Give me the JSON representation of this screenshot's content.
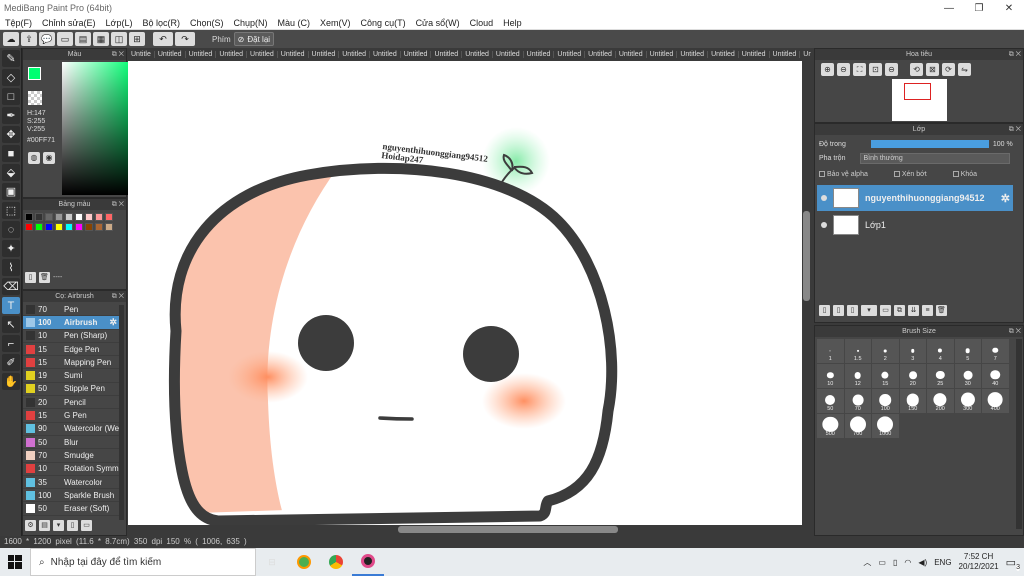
{
  "window": {
    "title": "MediBang Paint Pro (64bit)",
    "controls": [
      "—",
      "❐",
      "✕"
    ]
  },
  "menu": [
    "Tệp(F)",
    "Chỉnh sửa(E)",
    "Lớp(L)",
    "Bộ lọc(R)",
    "Chọn(S)",
    "Chụp(N)",
    "Màu (C)",
    "Xem(V)",
    "Công cụ(T)",
    "Cửa sổ(W)",
    "Cloud",
    "Help"
  ],
  "toolbar": {
    "label": "Phím",
    "reset_label": "Đặt lại",
    "reset_icon": "⊘"
  },
  "color_panel": {
    "title": "Màu",
    "h": "H:147",
    "s": "S:255",
    "v": "V:255",
    "hex": "#00FF71"
  },
  "palette_panel": {
    "title": "Bảng màu",
    "footer_text": "----",
    "colors": [
      "#000000",
      "#333333",
      "#666666",
      "#999999",
      "#cccccc",
      "#ffffff",
      "#ffcccc",
      "#ff9999",
      "#ff6666",
      "#ff0000",
      "#00ff00",
      "#0000ff",
      "#ffff00",
      "#00ffff",
      "#ff00ff",
      "#884400",
      "#aa6633",
      "#ccaa88"
    ]
  },
  "brush_panel": {
    "title": "Cọ: Airbrush",
    "brushes": [
      {
        "size": "70",
        "name": "Pen",
        "color": "#333333"
      },
      {
        "size": "100",
        "name": "Airbrush",
        "color": "#9ec8e8"
      },
      {
        "size": "10",
        "name": "Pen (Sharp)",
        "color": "#333333"
      },
      {
        "size": "15",
        "name": "Edge Pen",
        "color": "#e04040"
      },
      {
        "size": "15",
        "name": "Mapping Pen",
        "color": "#e04040"
      },
      {
        "size": "19",
        "name": "Sumi",
        "color": "#e0d020"
      },
      {
        "size": "50",
        "name": "Stipple Pen",
        "color": "#e0d020"
      },
      {
        "size": "20",
        "name": "Pencil",
        "color": "#333333"
      },
      {
        "size": "15",
        "name": "G Pen",
        "color": "#e04040"
      },
      {
        "size": "90",
        "name": "Watercolor (We",
        "color": "#60c0e0"
      },
      {
        "size": "50",
        "name": "Blur",
        "color": "#d070d0"
      },
      {
        "size": "70",
        "name": "Smudge",
        "color": "#f0d0c0"
      },
      {
        "size": "10",
        "name": "Rotation Symm",
        "color": "#e04040"
      },
      {
        "size": "35",
        "name": "Watercolor",
        "color": "#60c0e0"
      },
      {
        "size": "100",
        "name": "Sparkle Brush",
        "color": "#60c0e0"
      },
      {
        "size": "50",
        "name": "Eraser (Soft)",
        "color": "#ffffff"
      }
    ],
    "selected_index": 1
  },
  "doc_tabs": [
    "Untitle",
    "Untitled",
    "Untitled",
    "Untitled",
    "Untitled",
    "Untitled",
    "Untitled",
    "Untitled",
    "Untitled",
    "Untitled",
    "Untitled",
    "Untitled",
    "Untitled",
    "Untitled",
    "Untitled",
    "Untitled",
    "Untitled",
    "Untitled",
    "Untitled",
    "Untitled",
    "Untitled",
    "Untitled",
    "Untitled",
    "Untitled",
    "Untitled",
    "Untitled",
    "Untitled"
  ],
  "canvas": {
    "username": "nguyenthihuonggiang94512",
    "site": "Hoidap247"
  },
  "navigator": {
    "title": "Hoa tiêu"
  },
  "layer_panel": {
    "title": "Lớp",
    "opacity_label": "Độ trong",
    "opacity_value": "100 %",
    "blend_label": "Pha trộn",
    "blend_value": "Bình thường",
    "protect_alpha": "Bảo vệ alpha",
    "clipping": "Xén bớt",
    "lock": "Khóa",
    "layers": [
      {
        "name": "nguyenthihuonggiang94512",
        "selected": true
      },
      {
        "name": "Lớp1",
        "selected": false
      }
    ]
  },
  "brush_size_panel": {
    "title": "Brush Size",
    "sizes": [
      "1",
      "1.5",
      "2",
      "3",
      "4",
      "5",
      "7",
      "10",
      "12",
      "15",
      "20",
      "25",
      "30",
      "40",
      "50",
      "70",
      "100",
      "150",
      "200",
      "300",
      "400",
      "500",
      "700",
      "1000"
    ]
  },
  "status": {
    "text": "1600 * 1200 pixel   (11.6 * 8.7cm)   350 dpi   150 %   ( 1006, 635 )"
  },
  "taskbar": {
    "search_placeholder": "Nhập tại đây để tìm kiếm",
    "language": "ENG",
    "time": "7:52 CH",
    "date": "20/12/2021",
    "notification_count": "3"
  }
}
